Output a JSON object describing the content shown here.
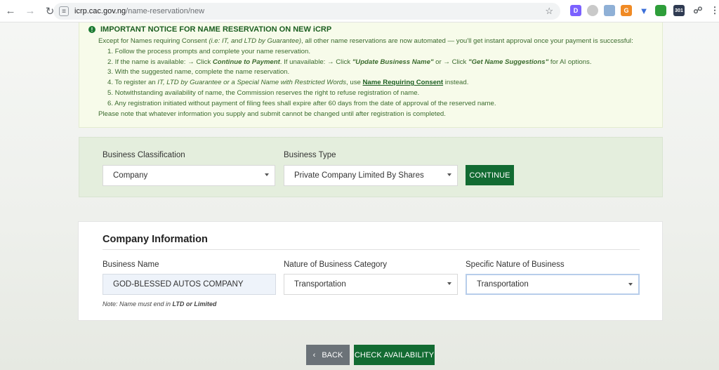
{
  "browser": {
    "url_host": "icrp.cac.gov.ng",
    "url_path": "/name-reservation/new",
    "extensions": [
      "D",
      "G",
      "301"
    ]
  },
  "notice": {
    "title": "IMPORTANT NOTICE FOR NAME RESERVATION ON NEW iCRP",
    "intro_a": "Except for Names requiring Consent ",
    "intro_italic": "(i.e: IT, and LTD by Guarantee)",
    "intro_b": ", all other name reservations are now automated — you'll get instant approval once your payment is successful:",
    "step1": "1. Follow the process prompts and complete your name reservation.",
    "step2_a": "2. If the name is available: → Click ",
    "step2_b": "Continue to Payment",
    "step2_c": ". If unavailable: → Click ",
    "step2_d": "\"Update Business Name\"",
    "step2_e": " or → Click ",
    "step2_f": "\"Get Name Suggestions\"",
    "step2_g": " for AI options.",
    "step3": "3. With the suggested name, complete the name reservation.",
    "step4_a": "4. To register an ",
    "step4_b": "IT, LTD by Guarantee or a Special Name with Restricted Words",
    "step4_c": ", use ",
    "step4_d": "Name Requiring Consent",
    "step4_e": " instead.",
    "step5": "5. Notwithstanding availability of name, the Commission reserves the right to refuse registration of name.",
    "step6": "6. Any registration initiated without payment of filing fees shall expire after 60 days from the date of approval of the reserved name.",
    "footer": "Please note that whatever information you supply and submit cannot be changed until after registration is completed."
  },
  "classification": {
    "business_classification_label": "Business Classification",
    "business_classification_value": "Company",
    "business_type_label": "Business Type",
    "business_type_value": "Private Company Limited By Shares",
    "continue_label": "CONTINUE"
  },
  "company_info": {
    "title": "Company Information",
    "business_name_label": "Business Name",
    "business_name_value": "GOD-BLESSED AUTOS COMPANY",
    "note_a": "Note: Name must end in ",
    "note_b": "LTD or Limited",
    "nature_category_label": "Nature of Business Category",
    "nature_category_value": "Transportation",
    "specific_nature_label": "Specific Nature of Business",
    "specific_nature_value": "Transportation"
  },
  "actions": {
    "back_label": "BACK",
    "check_label": "CHECK AVAILABILITY"
  },
  "colors": {
    "primary_green": "#126b32",
    "notice_bg": "#f7fbea",
    "panel_bg": "#e4eedd"
  }
}
